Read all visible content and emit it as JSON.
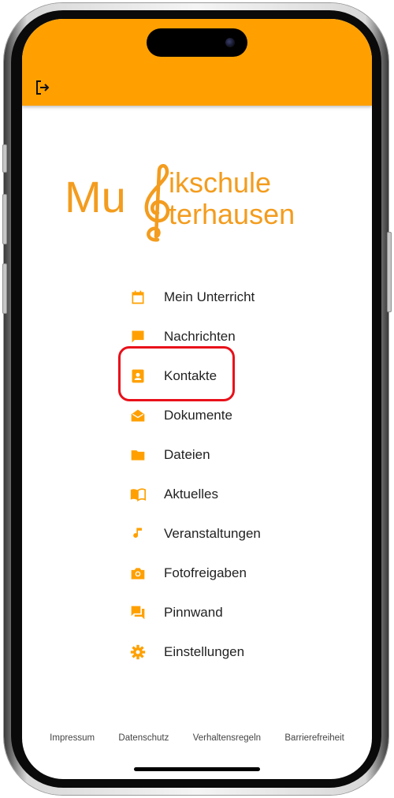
{
  "app": {
    "logo_line1": "Mu",
    "logo_line2": "ikschule",
    "logo_line3": "terhausen"
  },
  "menu": [
    {
      "label": "Mein Unterricht",
      "icon": "calendar-icon"
    },
    {
      "label": "Nachrichten",
      "icon": "chat-bubble-icon"
    },
    {
      "label": "Kontakte",
      "icon": "contact-card-icon"
    },
    {
      "label": "Dokumente",
      "icon": "envelope-open-icon"
    },
    {
      "label": "Dateien",
      "icon": "folder-icon"
    },
    {
      "label": "Aktuelles",
      "icon": "book-open-icon"
    },
    {
      "label": "Veranstaltungen",
      "icon": "music-note-icon"
    },
    {
      "label": "Fotofreigaben",
      "icon": "camera-icon"
    },
    {
      "label": "Pinnwand",
      "icon": "forum-icon"
    },
    {
      "label": "Einstellungen",
      "icon": "gear-icon"
    }
  ],
  "footer": {
    "impressum": "Impressum",
    "datenschutz": "Datenschutz",
    "verhaltensregeln": "Verhaltensregeln",
    "barrierefreiheit": "Barrierefreiheit"
  },
  "colors": {
    "accent": "#ffa000",
    "logo": "#f39c1e",
    "highlight": "#e8101a"
  }
}
